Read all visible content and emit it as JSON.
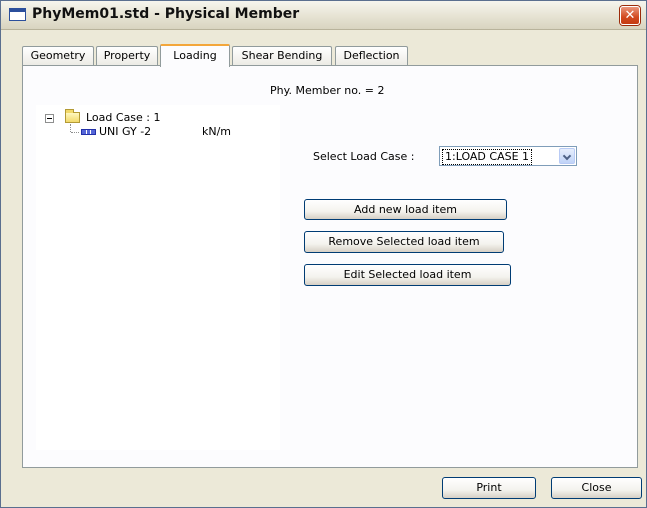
{
  "window": {
    "title": "PhyMem01.std - Physical Member",
    "close_glyph": "✕"
  },
  "tabs": [
    {
      "label": "Geometry",
      "active": false
    },
    {
      "label": "Property",
      "active": false
    },
    {
      "label": "Loading",
      "active": true
    },
    {
      "label": "Shear Bending",
      "active": false
    },
    {
      "label": "Deflection",
      "active": false
    }
  ],
  "loading": {
    "member_no": "Phy. Member no. = 2",
    "tree": {
      "root_label": "Load Case : 1",
      "child_label": "UNI GY -2",
      "child_unit": "kN/m"
    },
    "select_label": "Select Load Case :",
    "select_value": "1:LOAD CASE 1",
    "buttons": {
      "add": "Add new load item",
      "remove": "Remove Selected load item",
      "edit": "Edit Selected load item"
    }
  },
  "footer": {
    "print": "Print",
    "close": "Close"
  },
  "icons": {
    "title": "window-icon",
    "close": "close-icon",
    "tree_expander": "collapse-icon",
    "folder": "folder-icon",
    "load": "uniform-load-icon",
    "dropdown": "chevron-down-icon"
  }
}
